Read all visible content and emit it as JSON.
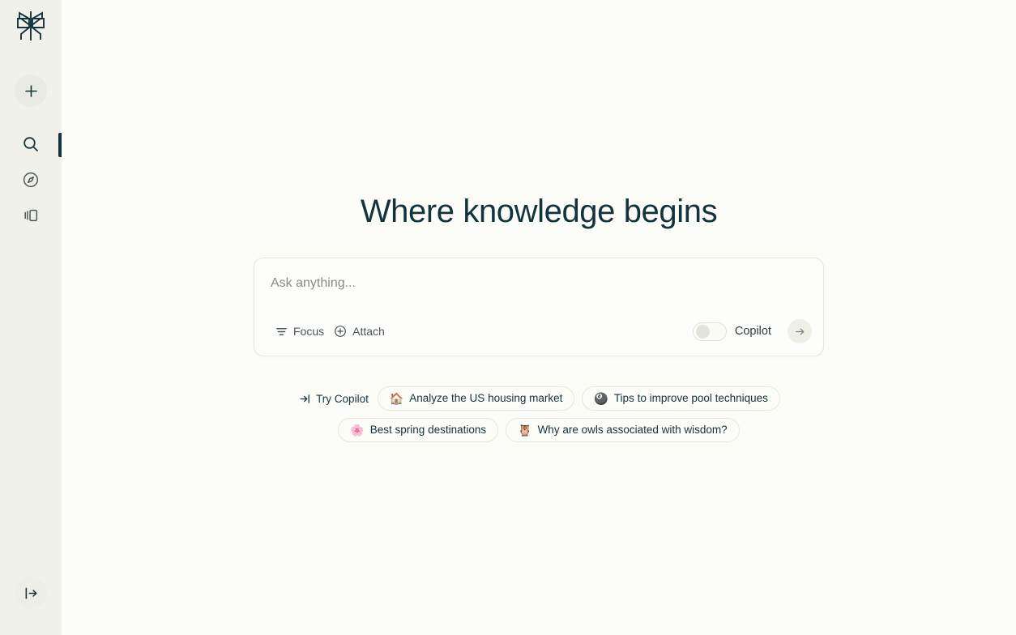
{
  "app": {
    "brand_logo": "perplexity-logo",
    "background_color": "#fcfcf9",
    "sidebar_color": "#f1f1ec",
    "accent_color": "#13343b"
  },
  "sidebar": {
    "new_thread": {
      "label": "",
      "icon": "plus-icon"
    },
    "items": [
      {
        "id": "home",
        "icon": "search-icon",
        "label": "",
        "active": true
      },
      {
        "id": "discover",
        "icon": "compass-icon",
        "label": "",
        "active": false
      },
      {
        "id": "library",
        "icon": "library-icon",
        "label": "",
        "active": false
      }
    ],
    "bottom": {
      "icon": "expand-sidebar-icon",
      "label": ""
    }
  },
  "main": {
    "headline": "Where knowledge begins"
  },
  "search": {
    "placeholder": "Ask anything...",
    "value": "",
    "focus_label": "Focus",
    "focus_icon": "filter-icon",
    "attach_label": "Attach",
    "attach_icon": "plus-circle-icon",
    "copilot_label": "Copilot",
    "copilot_enabled": false,
    "submit_icon": "arrow-right-icon"
  },
  "suggestions": {
    "try_copilot_label": "Try Copilot",
    "try_copilot_icon": "arrow-right-to-bracket-icon",
    "row1": [
      {
        "emoji": "🏠",
        "emoji_name": "house-emoji",
        "label": "Analyze the US housing market"
      },
      {
        "emoji": "🎱",
        "emoji_name": "pool-8-ball-emoji",
        "label": "Tips to improve pool techniques"
      }
    ],
    "row2": [
      {
        "emoji": "🌸",
        "emoji_name": "cherry-blossom-emoji",
        "label": "Best spring destinations"
      },
      {
        "emoji": "🦉",
        "emoji_name": "owl-emoji",
        "label": "Why are owls associated with wisdom?"
      }
    ]
  }
}
